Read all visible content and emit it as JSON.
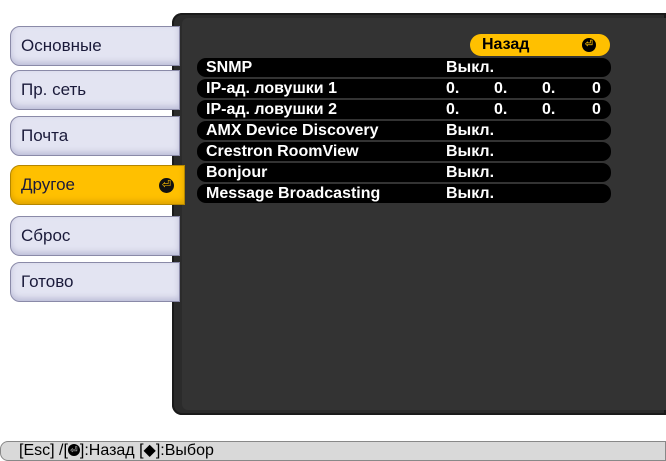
{
  "sidebar": {
    "items": [
      {
        "label": "Основные"
      },
      {
        "label": "Пр. сеть"
      },
      {
        "label": "Почта"
      },
      {
        "label": "Другое",
        "active": true
      },
      {
        "label": "Сброс"
      },
      {
        "label": "Готово"
      }
    ]
  },
  "main": {
    "back_label": "Назад",
    "rows": [
      {
        "label": "SNMP",
        "value": "Выкл."
      },
      {
        "label": "IP-ад. ловушки 1",
        "ip": [
          "0.",
          "0.",
          "0.",
          "0"
        ]
      },
      {
        "label": "IP-ад. ловушки 2",
        "ip": [
          "0.",
          "0.",
          "0.",
          "0"
        ]
      },
      {
        "label": "AMX Device Discovery",
        "value": "Выкл."
      },
      {
        "label": "Crestron RoomView",
        "value": "Выкл."
      },
      {
        "label": "Bonjour",
        "value": "Выкл."
      },
      {
        "label": "Message Broadcasting",
        "value": "Выкл."
      }
    ]
  },
  "footer": {
    "esc_text": "[Esc] /[",
    "back_text": "]:Назад  [",
    "arrows_glyph": "◆",
    "select_text": "]:Выбор"
  },
  "colors": {
    "accent": "#ffc000",
    "panel": "#333333",
    "tab": "#e3e4f2"
  },
  "icons": {
    "enter": "enter-icon",
    "updown": "up-down-arrows-icon"
  }
}
